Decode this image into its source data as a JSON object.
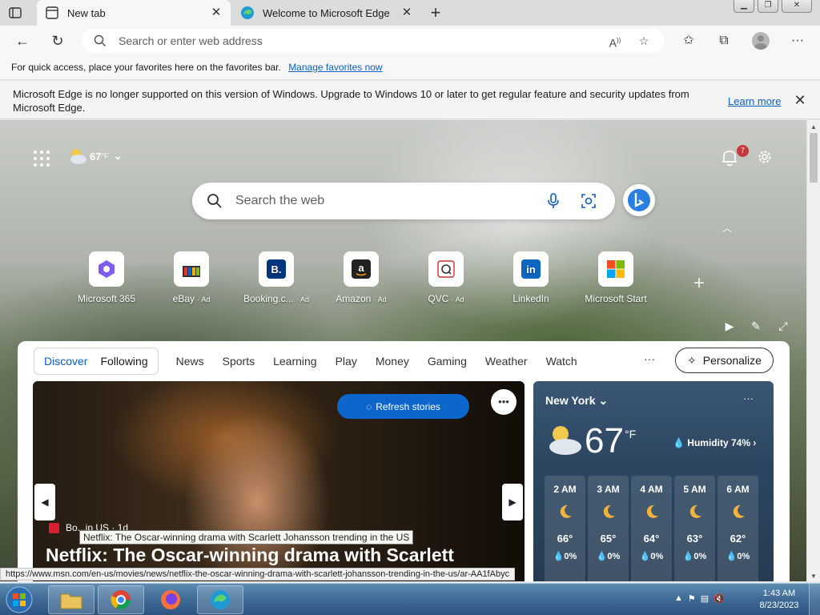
{
  "tabs": [
    {
      "title": "New tab",
      "active": true
    },
    {
      "title": "Welcome to Microsoft Edge",
      "active": false
    }
  ],
  "toolbar": {
    "address_placeholder": "Search or enter web address"
  },
  "favbar": {
    "text": "For quick access, place your favorites here on the favorites bar.",
    "link": "Manage favorites now"
  },
  "infobar": {
    "message": "Microsoft Edge is no longer supported on this version of Windows. Upgrade to Windows 10 or later to get regular feature and security updates from Microsoft Edge.",
    "link": "Learn more"
  },
  "weather_mini": {
    "temp": "67",
    "unit": "°F"
  },
  "notifications": {
    "count": "7"
  },
  "websearch": {
    "placeholder": "Search the web"
  },
  "tiles": [
    {
      "label": "Microsoft 365",
      "ad": ""
    },
    {
      "label": "eBay",
      "ad": "· Ad"
    },
    {
      "label": "Booking.c...",
      "ad": "· Ad"
    },
    {
      "label": "Amazon",
      "ad": "· Ad"
    },
    {
      "label": "QVC",
      "ad": "· Ad"
    },
    {
      "label": "LinkedIn",
      "ad": ""
    },
    {
      "label": "Microsoft Start",
      "ad": ""
    }
  ],
  "feed": {
    "segment": [
      "Discover",
      "Following"
    ],
    "tabs": [
      "News",
      "Sports",
      "Learning",
      "Play",
      "Money",
      "Gaming",
      "Weather",
      "Watch"
    ],
    "more": "···",
    "personalize": "Personalize",
    "refresh": "Refresh stories",
    "source": "Bo...ip US · 1d",
    "tooltip": "Netflix: The Oscar-winning drama with Scarlett Johansson trending in the US",
    "headline": "Netflix: The Oscar-winning drama with Scarlett"
  },
  "weather": {
    "city": "New York",
    "temp": "67",
    "unit": "°F",
    "humidity": "Humidity 74%",
    "hours": [
      {
        "time": "2 AM",
        "temp": "66°",
        "precip": "0%"
      },
      {
        "time": "3 AM",
        "temp": "65°",
        "precip": "0%"
      },
      {
        "time": "4 AM",
        "temp": "64°",
        "precip": "0%"
      },
      {
        "time": "5 AM",
        "temp": "63°",
        "precip": "0%"
      },
      {
        "time": "6 AM",
        "temp": "62°",
        "precip": "0%"
      }
    ]
  },
  "status_url": "https://www.msn.com/en-us/movies/news/netflix-the-oscar-winning-drama-with-scarlett-johansson-trending-in-the-us/ar-AA1fAbyc",
  "clock": {
    "time": "1:43 AM",
    "date": "8/23/2023"
  },
  "colors": {
    "accent": "#0c5ec2",
    "refresh_button": "#0c66cc",
    "badge": "#c4393b"
  }
}
